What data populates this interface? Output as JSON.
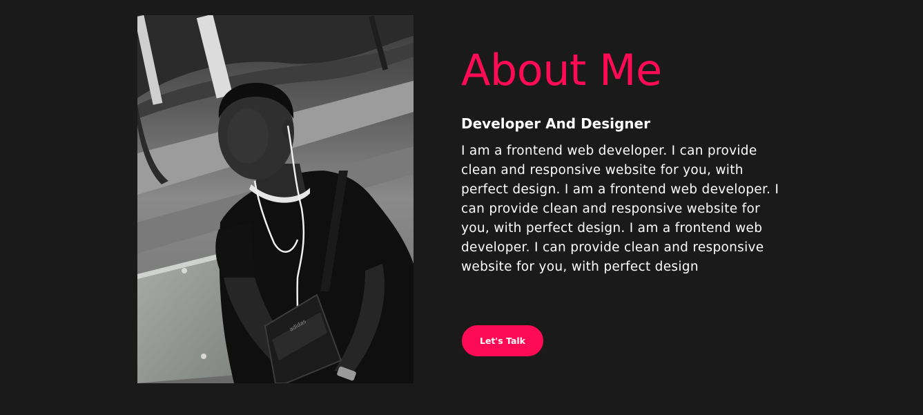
{
  "about": {
    "heading": "About Me",
    "subheading": "Developer And Designer",
    "bio": "I am a frontend web developer. I can provide clean and responsive website for you, with perfect design. I am a frontend web developer. I can provide clean and responsive website for you, with perfect design. I am a frontend web developer. I can provide clean and responsive website for you, with perfect design",
    "cta_label": "Let's Talk",
    "bag_text": "adidas"
  },
  "colors": {
    "background": "#1a1a1a",
    "accent": "#ff0a54",
    "text": "#ffffff"
  }
}
